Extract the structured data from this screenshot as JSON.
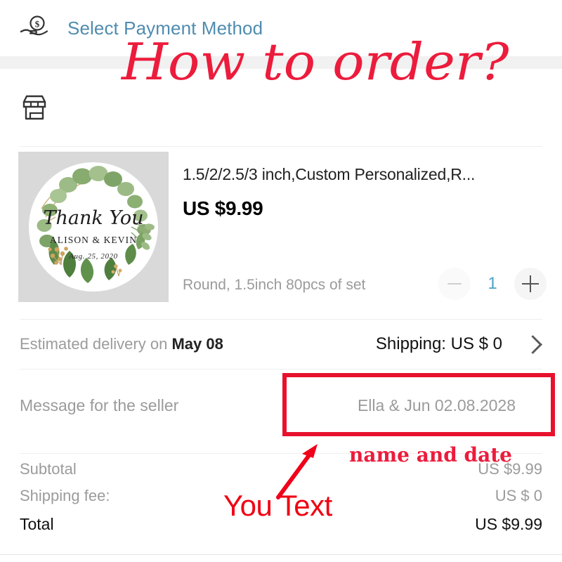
{
  "header": {
    "payment_icon": "hand-holding-money-icon",
    "payment_label": "Select Payment Method",
    "store_icon": "storefront-icon"
  },
  "product": {
    "image_alt": "thank-you-greenery-round-sticker",
    "sticker": {
      "script_text": "Thank You",
      "names": "ALISON & KEVIN",
      "date": "Aug. 25, 2020"
    },
    "title": "1.5/2/2.5/3 inch,Custom Personalized,R...",
    "price": "US $9.99",
    "variant": "Round, 1.5inch 80pcs of set",
    "quantity": "1",
    "minus_label": "−",
    "plus_label": "+"
  },
  "delivery": {
    "prefix": "Estimated delivery on",
    "date": "May 08",
    "shipping": "Shipping: US $ 0",
    "chevron_icon": "chevron-right-icon"
  },
  "message": {
    "label": "Message for the seller",
    "value": "Ella & Jun 02.08.2028",
    "placeholder": "Ella & Jun 02.08.2028"
  },
  "totals": {
    "rows": [
      {
        "label": "Subtotal",
        "value": "US $9.99"
      },
      {
        "label": "Shipping fee:",
        "value": "US $ 0"
      }
    ],
    "grand": {
      "label": "Total",
      "value": "US $9.99"
    }
  },
  "annotations": {
    "title": "How to order?",
    "name_and_date": "name and date",
    "you_text": "You Text",
    "arrow_icon": "red-arrow-up-right-icon",
    "highlight_icon": "red-highlight-box"
  },
  "colors": {
    "accent_blue": "#4f8cb0",
    "qty_blue": "#4aa3c7",
    "annotation_red": "#ec1c3c",
    "box_red": "#e8112d",
    "muted": "#9b9b9b"
  }
}
